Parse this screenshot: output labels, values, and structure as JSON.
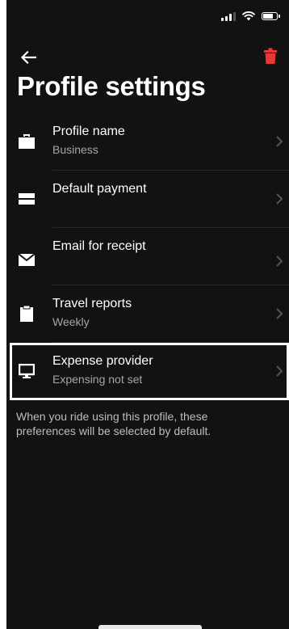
{
  "header": {
    "title": "Profile settings",
    "back_icon": "arrow-left-icon",
    "delete_icon": "trash-icon",
    "delete_color": "#e53935"
  },
  "status_bar": {
    "icons": [
      "signal-icon",
      "wifi-icon",
      "battery-icon"
    ]
  },
  "settings": {
    "items": [
      {
        "icon": "briefcase-icon",
        "label": "Profile name",
        "sublabel": "Business"
      },
      {
        "icon": "credit-card-icon",
        "label": "Default payment",
        "sublabel": ""
      },
      {
        "icon": "envelope-icon",
        "label": "Email for receipt",
        "sublabel": ""
      },
      {
        "icon": "clipboard-icon",
        "label": "Travel reports",
        "sublabel": "Weekly"
      },
      {
        "icon": "monitor-icon",
        "label": "Expense provider",
        "sublabel": "Expensing not set",
        "highlighted": true
      }
    ]
  },
  "footer": {
    "note": "When you ride using this profile, these preferences will be selected by default."
  },
  "colors": {
    "background": "#121212",
    "text_primary": "#ffffff",
    "text_secondary": "#a6a6a6",
    "accent_delete": "#e53935"
  }
}
